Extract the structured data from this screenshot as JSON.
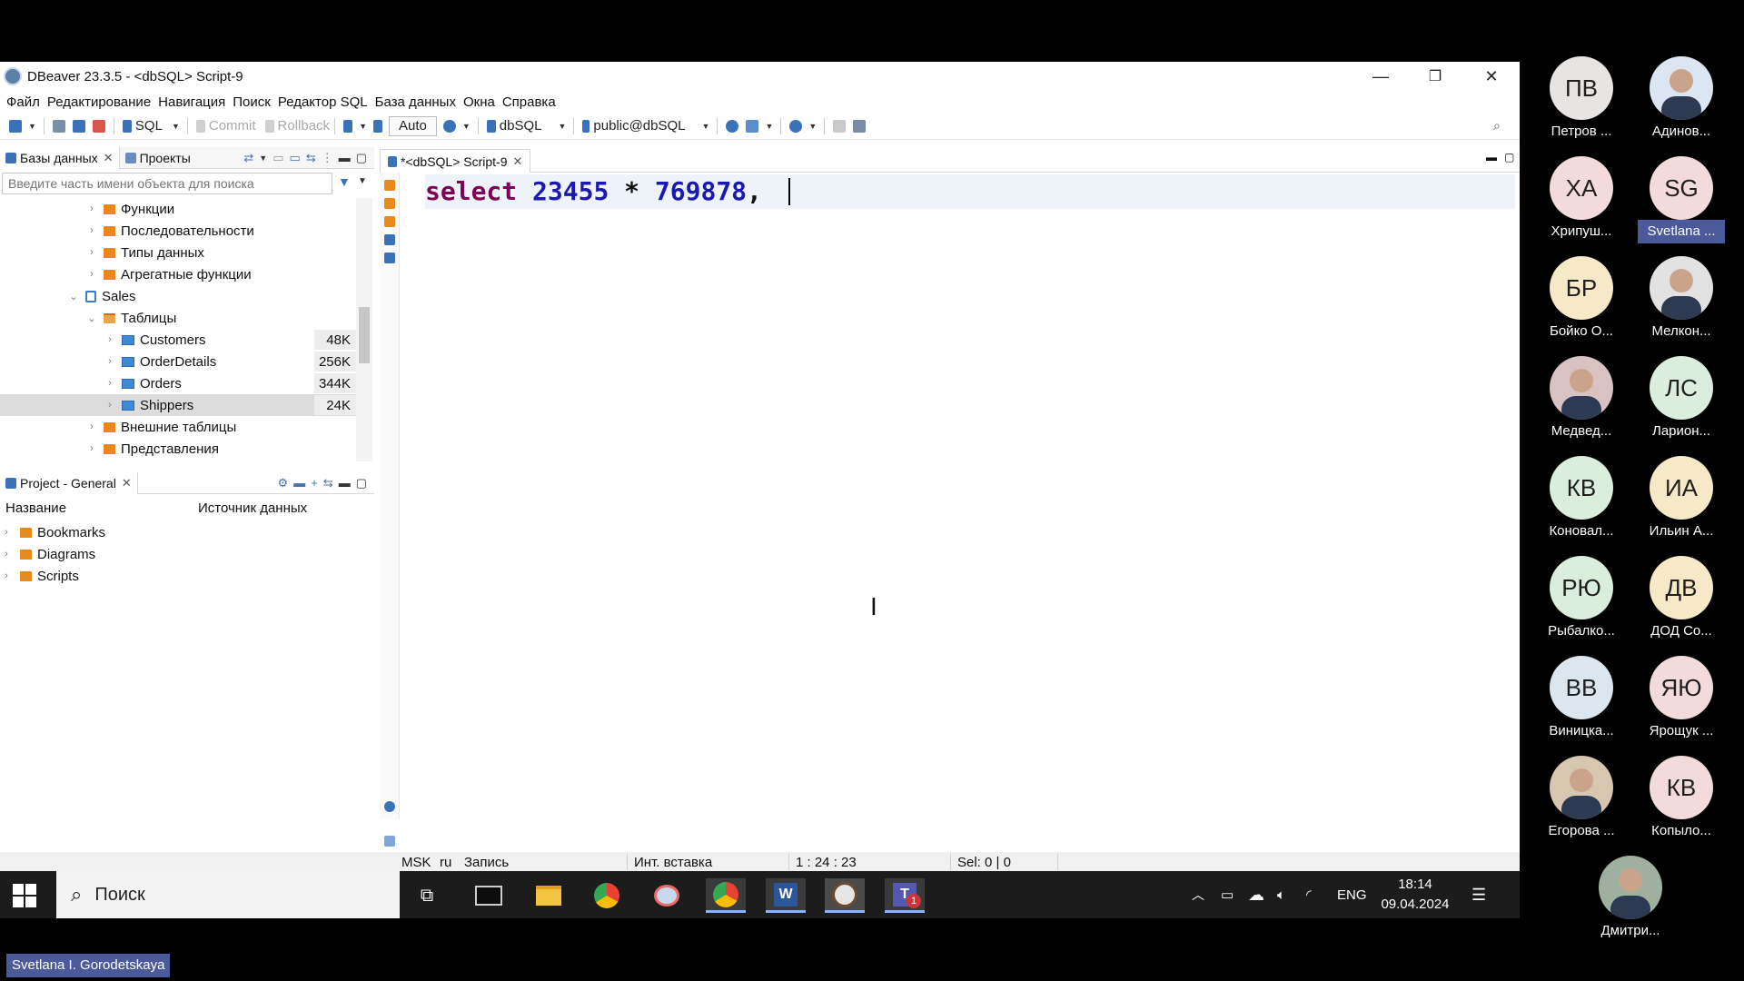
{
  "window": {
    "title": "DBeaver 23.3.5 - <dbSQL> Script-9",
    "controls": {
      "minimize": "—",
      "restore": "❐",
      "close": "✕"
    }
  },
  "menu": [
    "Файл",
    "Редактирование",
    "Навигация",
    "Поиск",
    "Редактор SQL",
    "База данных",
    "Окна",
    "Справка"
  ],
  "toolbar": {
    "sql_label": "SQL",
    "commit_label": "Commit",
    "rollback_label": "Rollback",
    "mode_label": "Auto",
    "datasource_label": "dbSQL",
    "schema_label": "public@dbSQL"
  },
  "db_panel": {
    "tab_databases": "Базы данных",
    "tab_projects": "Проекты",
    "search_placeholder": "Введите часть имени объекта для поиска",
    "tree": [
      {
        "label": "Функции",
        "level": 2,
        "expanded": false,
        "icon": "folder-icon"
      },
      {
        "label": "Последовательности",
        "level": 2,
        "expanded": false,
        "icon": "folder-icon"
      },
      {
        "label": "Типы данных",
        "level": 2,
        "expanded": false,
        "icon": "folder-icon"
      },
      {
        "label": "Агрегатные функции",
        "level": 2,
        "expanded": false,
        "icon": "folder-icon"
      },
      {
        "label": "Sales",
        "level": 1,
        "expanded": true,
        "icon": "schema-icon"
      },
      {
        "label": "Таблицы",
        "level": 2,
        "expanded": true,
        "icon": "folder-open-icon"
      },
      {
        "label": "Customers",
        "level": 3,
        "expanded": false,
        "icon": "table-icon",
        "size": "48K"
      },
      {
        "label": "OrderDetails",
        "level": 3,
        "expanded": false,
        "icon": "table-icon",
        "size": "256K"
      },
      {
        "label": "Orders",
        "level": 3,
        "expanded": false,
        "icon": "table-icon",
        "size": "344K"
      },
      {
        "label": "Shippers",
        "level": 3,
        "expanded": false,
        "icon": "table-icon",
        "size": "24K",
        "selected": true
      },
      {
        "label": "Внешние таблицы",
        "level": 2,
        "expanded": false,
        "icon": "folder-icon"
      },
      {
        "label": "Представления",
        "level": 2,
        "expanded": false,
        "icon": "folder-icon"
      }
    ]
  },
  "project_panel": {
    "title": "Project - General",
    "col_name": "Название",
    "col_source": "Источник данных",
    "items": [
      "Bookmarks",
      "Diagrams",
      "Scripts"
    ]
  },
  "editor": {
    "tab_label": "*<dbSQL> Script-9",
    "code": {
      "keyword": "select",
      "n1": "23455",
      "op": "*",
      "n2": "769878",
      "tail": ","
    }
  },
  "status": {
    "tz": "MSK",
    "lang": "ru",
    "mode": "Запись",
    "insert": "Инт. вставка",
    "position": "1 : 24 : 23",
    "selection": "Sel: 0 | 0"
  },
  "taskbar": {
    "search_label": "Поиск",
    "lang": "ENG",
    "time": "18:14",
    "date": "09.04.2024",
    "teams_badge": "1"
  },
  "participants": [
    {
      "initials": "ПВ",
      "name": "Петров ...",
      "color": "#e7e4e2"
    },
    {
      "initials": "",
      "name": "Адинов...",
      "color": "#dbe6f2",
      "photo": true
    },
    {
      "initials": "ХА",
      "name": "Хрипуш...",
      "color": "#f3dadb"
    },
    {
      "initials": "SG",
      "name": "Svetlana ...",
      "color": "#f3dadb",
      "highlight": true
    },
    {
      "initials": "БР",
      "name": "Бойко О...",
      "color": "#f6e9c8"
    },
    {
      "initials": "",
      "name": "Мелкон...",
      "color": "#e2e2e2",
      "photo": true
    },
    {
      "initials": "",
      "name": "Медвед...",
      "color": "#d9c2c2",
      "photo": true
    },
    {
      "initials": "ЛС",
      "name": "Ларион...",
      "color": "#dbeedd"
    },
    {
      "initials": "КВ",
      "name": "Коновал...",
      "color": "#dbeedd"
    },
    {
      "initials": "ИА",
      "name": "Ильин А...",
      "color": "#f6e9c8"
    },
    {
      "initials": "РЮ",
      "name": "Рыбалко...",
      "color": "#dbeedd"
    },
    {
      "initials": "ДВ",
      "name": "ДОД Со...",
      "color": "#f6e9c8"
    },
    {
      "initials": "ВВ",
      "name": "Виницка...",
      "color": "#dce6ef"
    },
    {
      "initials": "ЯЮ",
      "name": "Ярощук ...",
      "color": "#f3dadb"
    },
    {
      "initials": "",
      "name": "Егорова ...",
      "color": "#d8c7b0",
      "photo": true
    },
    {
      "initials": "КВ",
      "name": "Копыло...",
      "color": "#f3dadb"
    },
    {
      "initials": "",
      "name": "Дмитри...",
      "color": "#9fb0a0",
      "photo": true
    }
  ],
  "speaker_label": "Svetlana I. Gorodetskaya"
}
